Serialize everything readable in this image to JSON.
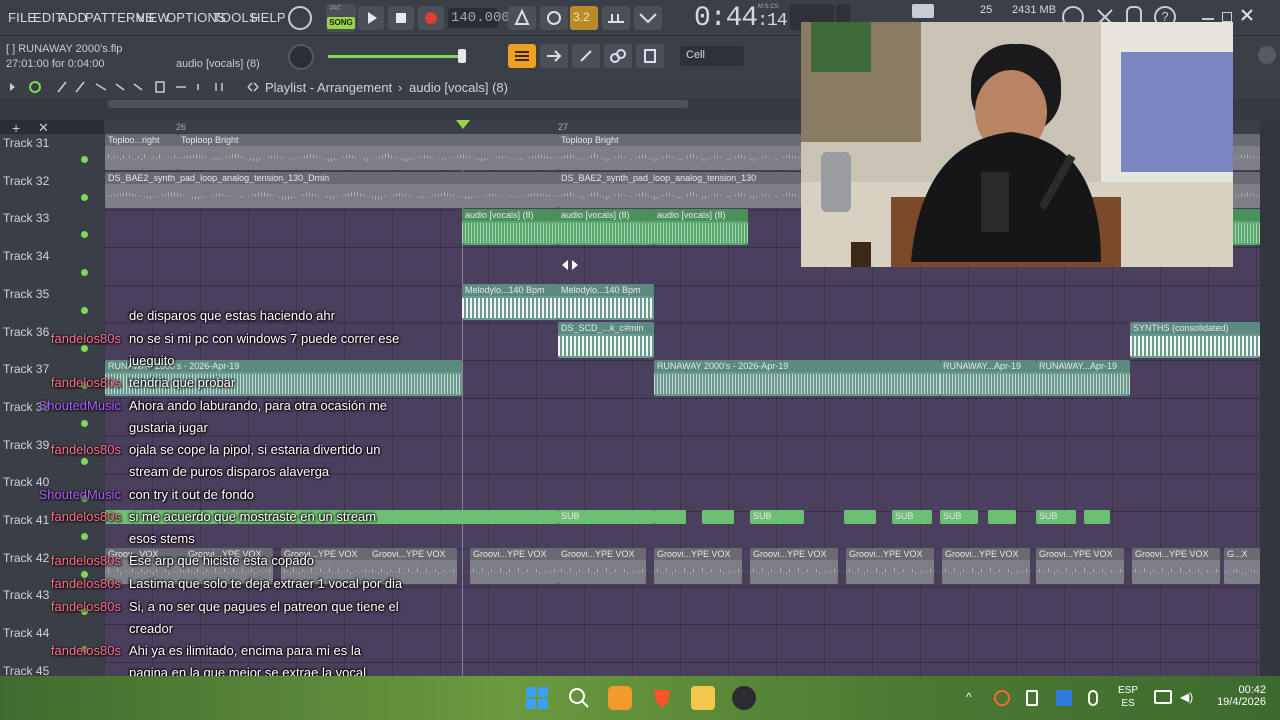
{
  "menu": [
    "FILE",
    "EDIT",
    "ADD",
    "PATTERNS",
    "VIEW",
    "OPTIONS",
    "TOOLS",
    "HELP"
  ],
  "transport": {
    "pat_label": "PAT",
    "song_label": "SONG",
    "tempo": "140.000",
    "time": "0:44",
    "time_small": ":14",
    "time_unit": "M:S:CS",
    "cpu": "25",
    "memory": "2431 MB"
  },
  "project": {
    "filename": "[  ] RUNAWAY 2000's.flp",
    "timing": "27:01:00 for 0:04:00",
    "channel": "audio [vocals] (8)",
    "snap": "Cell"
  },
  "playlist": {
    "title": "Playlist - Arrangement",
    "crumb": "audio [vocals] (8)",
    "bar_26": "26",
    "bar_27": "27"
  },
  "tracks": [
    "Track 31",
    "Track 32",
    "Track 33",
    "Track 34",
    "Track 35",
    "Track 36",
    "Track 37",
    "Track 38",
    "Track 39",
    "Track 40",
    "Track 41",
    "Track 42",
    "Track 43",
    "Track 44",
    "Track 45"
  ],
  "clips": {
    "t31a": "Toploo...right",
    "t31b": "Toploop Bright",
    "t31c": "Toploop Bright",
    "t32a": "DS_BAE2_synth_pad_loop_analog_tension_130_Dmin",
    "t32b": "DS_BAE2_synth_pad_loop_analog_tension_130",
    "t33a": "audio [vocals] (8)",
    "t33b": "audio [vocals] (8)",
    "t33c": "audio [vocals] (8)",
    "t35a": "Melodylo...140 Bpm",
    "t35b": "Melodylo...140 Bpm",
    "t36a": "DS_SCD_...k_c#min",
    "t36b": "SYNTHS (consolidated)",
    "t37a": "RUNAWAY 2000's - 2026-Apr-19",
    "t37b": "RUNAWAY 2000's - 2026-Apr-19",
    "t37c": "RUNAWAY...Apr-19",
    "t37d": "RUNAWAY...Apr-19",
    "sub": "SUB",
    "vox": "Groovi...YPE VOX",
    "vox_first": "Groov...VOX",
    "vox_last": "G...X"
  },
  "chat": [
    {
      "user": "",
      "text": "de disparos que estas haciendo ahr"
    },
    {
      "user": "fandelos80s",
      "text": "no se si mi pc con windows 7 puede correr ese"
    },
    {
      "user": "",
      "text": "jueguito"
    },
    {
      "user": "fandelos80s",
      "text": "tendria que probar"
    },
    {
      "user": "ShoutedMusic",
      "text": "Ahora ando laburando, para otra ocasión me"
    },
    {
      "user": "",
      "text": "gustaria jugar"
    },
    {
      "user": "fandelos80s",
      "text": "ojala se cope la pipol, si estaria divertido un"
    },
    {
      "user": "",
      "text": "stream de puros disparos alaverga"
    },
    {
      "user": "ShoutedMusic",
      "text": "con try it out de fondo"
    },
    {
      "user": "fandelos80s",
      "text": "si me acuerdo que mostraste en un stream"
    },
    {
      "user": "",
      "text": "esos stems"
    },
    {
      "user": "fandelos80s",
      "text": "Ese arp que hiciste esta copado"
    },
    {
      "user": "fandelos80s",
      "text": "Lastima que solo te deja extraer 1 vocal por dia"
    },
    {
      "user": "fandelos80s",
      "text": "Si, a no ser que pagues el patreon que tiene el"
    },
    {
      "user": "",
      "text": "creador"
    },
    {
      "user": "fandelos80s",
      "text": "Ahi ya es ilimitado, encima para mi es la"
    },
    {
      "user": "",
      "text": "pagina en la que mejor se extrae la vocal"
    }
  ],
  "taskbar": {
    "lang1": "ESP",
    "lang2": "ES",
    "time": "00:42",
    "date": "19/4/2026"
  }
}
